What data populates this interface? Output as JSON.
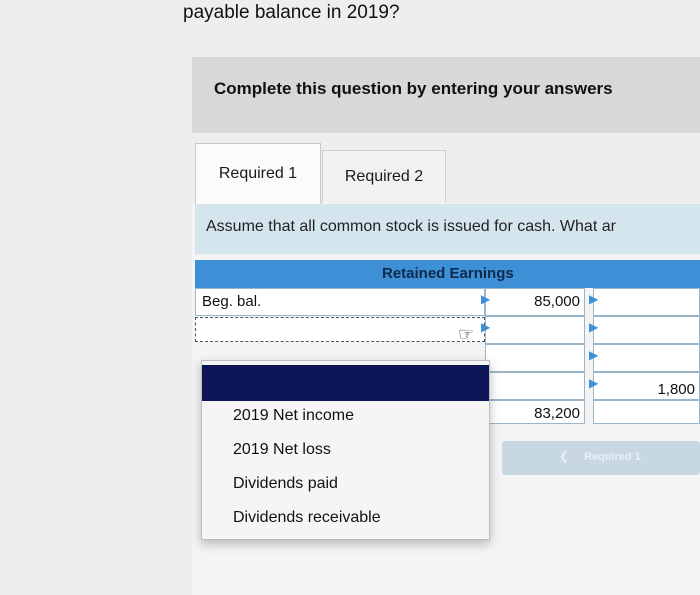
{
  "question": {
    "text": "payable balance in 2019?"
  },
  "instruction": {
    "text": "Complete this question by entering your answers"
  },
  "tabs": [
    {
      "label": "Required 1"
    },
    {
      "label": "Required 2"
    }
  ],
  "assume": {
    "text": "Assume that all common stock is issued for cash. What ar"
  },
  "account": {
    "title": "Retained Earnings",
    "rows": [
      {
        "label": "Beg. bal.",
        "value": "85,000"
      },
      {
        "label": "",
        "value": ""
      },
      {
        "label": "",
        "value": ""
      },
      {
        "label": "",
        "value": "",
        "right_value": "1,800"
      },
      {
        "label": "",
        "value": "83,200"
      }
    ]
  },
  "dropdown": {
    "options": [
      {
        "label": ""
      },
      {
        "label": "2019 Net income"
      },
      {
        "label": "2019 Net loss"
      },
      {
        "label": "Dividends paid"
      },
      {
        "label": "Dividends receivable"
      }
    ]
  },
  "navigation": {
    "prev_label": "Required 1",
    "prev_icon": "chevron-left-icon"
  },
  "colors": {
    "header_blue": "#3d8fd6",
    "highlight_navy": "#0e1557",
    "assume_bg": "#d4e5ee"
  }
}
